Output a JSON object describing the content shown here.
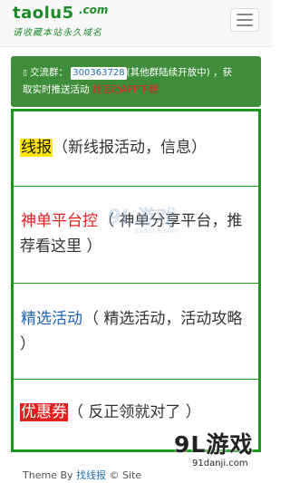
{
  "header": {
    "logo_main": "taolu5",
    "logo_com": ".com",
    "logo_slogan": "请收藏本站永久域名"
  },
  "notice": {
    "chat_icon": "chat-bubble-icon",
    "prefix": "交流群：",
    "qq_number": "300363728",
    "line1_suffix": "(其他群陆续开放中) ，获",
    "line2_prefix": "取实时推送活动 ",
    "app_link": "找活动APP下载"
  },
  "list": {
    "items": [
      {
        "tag": "线报",
        "desc": "（新线报活动，信息）"
      },
      {
        "tag": "神单平台控",
        "desc": "（ 神单分享平台，推荐看这里 ）"
      },
      {
        "tag": "精选活动",
        "desc": "（ 精选活动，活动攻略 ）"
      },
      {
        "tag": "优惠券",
        "desc": "（ 反正领就对了 ）"
      }
    ]
  },
  "watermarks": {
    "mid_big": "9L游戏",
    "mid_small": "91danji.com",
    "corner_big": "9L游戏",
    "corner_small": "91danji.com"
  },
  "footer": {
    "prefix": "Theme By ",
    "author": "找线报",
    "middle": " © Site"
  },
  "colors": {
    "brand_green": "#1f8a2c",
    "notice_bg": "#3f8d3a",
    "list_border": "#1a9a1a",
    "highlight_yellow": "#ffe500",
    "highlight_red": "#e31e1e",
    "link_blue": "#1f64b5"
  }
}
